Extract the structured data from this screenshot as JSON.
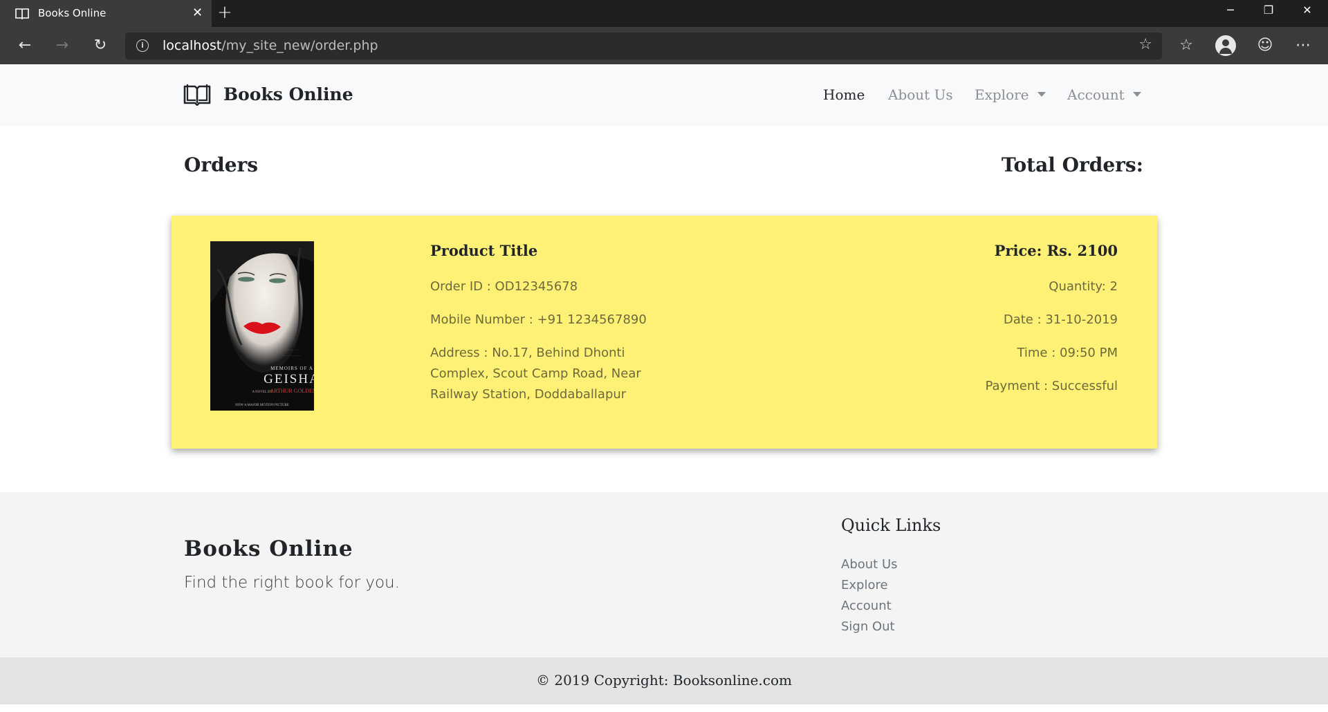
{
  "browser": {
    "tab_title": "Books Online",
    "url_host": "localhost",
    "url_path": "/my_site_new/order.php",
    "icons": [
      "book-icon",
      "close-icon",
      "plus-icon",
      "minimize-icon",
      "restore-icon",
      "window-close-icon",
      "back-icon",
      "forward-icon",
      "refresh-icon",
      "info-icon",
      "favorite-star-icon",
      "favorites-list-icon",
      "profile-icon",
      "feedback-smiley-icon",
      "more-icon"
    ]
  },
  "navbar": {
    "brand": "Books Online",
    "links": {
      "home": "Home",
      "about": "About Us",
      "explore": "Explore",
      "account": "Account"
    }
  },
  "orders": {
    "title": "Orders",
    "total_label": "Total Orders:"
  },
  "order": {
    "product_title": "Product Title",
    "order_id": "Order ID : OD12345678",
    "mobile": "Mobile Number : +91 1234567890",
    "address": "Address : No.17, Behind Dhonti Complex, Scout Camp Road, Near Railway Station, Doddaballapur",
    "price": "Price: Rs. 2100",
    "quantity": "Quantity: 2",
    "date": "Date : 31-10-2019",
    "time": "Time : 09:50 PM",
    "payment": "Payment : Successful",
    "cover": {
      "series": "MEMOIRS OF A",
      "title": "GEISHA",
      "byline_prefix": "A NOVEL BY",
      "author": "ARTHUR GOLDEN",
      "tagline": "NOW A MAJOR MOTION PICTURE"
    }
  },
  "footer": {
    "brand": "Books Online",
    "tagline": "Find the right book for you.",
    "quick_links_title": "Quick Links",
    "quick_links": [
      "About Us",
      "Explore",
      "Account",
      "Sign Out"
    ],
    "copyright": "© 2019 Copyright: Booksonline.com"
  },
  "colors": {
    "order_card": "#fff176",
    "navbar_bg": "#f8f9fa",
    "footer_bg": "#f4f4f4",
    "copyright_bg": "#e4e4e4",
    "browser_chrome": "#3b3b3b"
  }
}
